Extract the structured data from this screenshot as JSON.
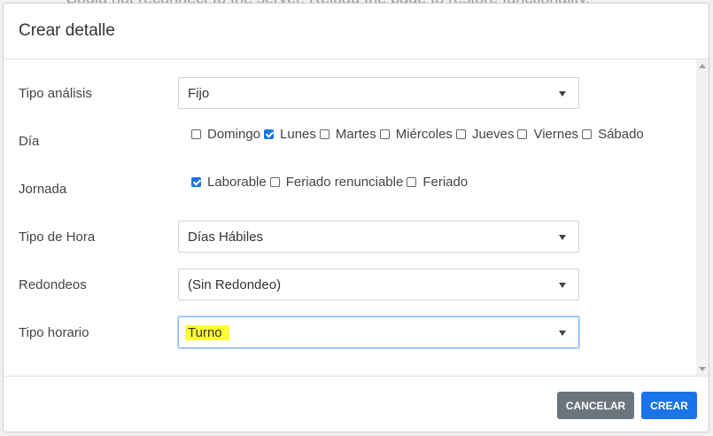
{
  "background_text": "Could not reconnect to the server. Reload the page to restore functionality.",
  "modal": {
    "title": "Crear detalle"
  },
  "form": {
    "tipo_analisis": {
      "label": "Tipo análisis",
      "value": "Fijo"
    },
    "dia": {
      "label": "Día",
      "options": [
        {
          "label": "Domingo",
          "checked": false
        },
        {
          "label": "Lunes",
          "checked": true
        },
        {
          "label": "Martes",
          "checked": false
        },
        {
          "label": "Miércoles",
          "checked": false
        },
        {
          "label": "Jueves",
          "checked": false
        },
        {
          "label": "Viernes",
          "checked": false
        },
        {
          "label": "Sábado",
          "checked": false
        }
      ]
    },
    "jornada": {
      "label": "Jornada",
      "options": [
        {
          "label": "Laborable",
          "checked": true
        },
        {
          "label": "Feriado renunciable",
          "checked": false
        },
        {
          "label": "Feriado",
          "checked": false
        }
      ]
    },
    "tipo_hora": {
      "label": "Tipo de Hora",
      "value": "Días Hábiles"
    },
    "redondeos": {
      "label": "Redondeos",
      "value": "(Sin Redondeo)"
    },
    "tipo_horario": {
      "label": "Tipo horario",
      "value": "Turno"
    }
  },
  "footer": {
    "cancel_label": "CANCELAR",
    "create_label": "CREAR"
  },
  "colors": {
    "primary": "#1a73e8",
    "secondary": "#6c757d",
    "highlight": "#ffff33"
  }
}
